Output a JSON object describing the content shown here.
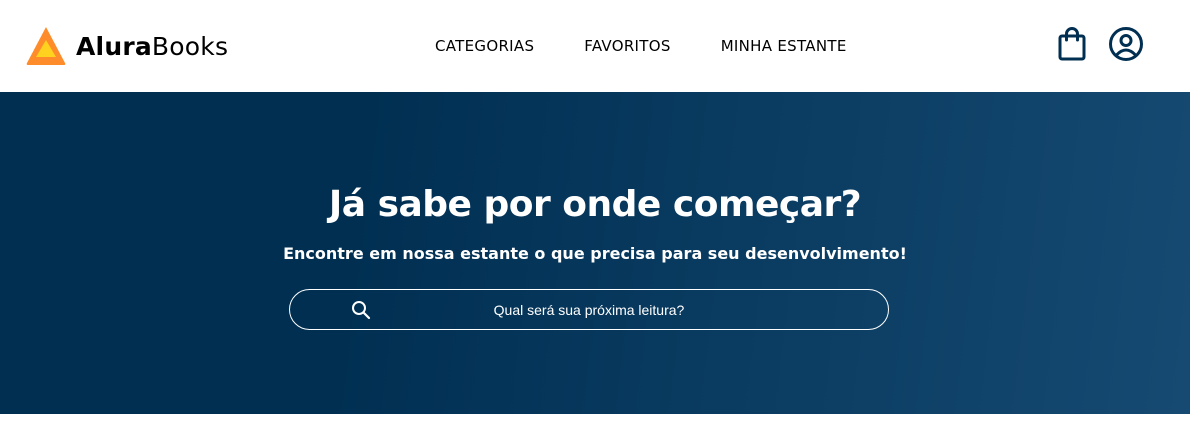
{
  "brand": {
    "name_strong": "Alura",
    "name_rest": "Books",
    "logo_colors": {
      "outer": "#ff8c2a",
      "inner": "#ffd21f"
    }
  },
  "nav": {
    "items": [
      {
        "label": "CATEGORIAS"
      },
      {
        "label": "FAVORITOS"
      },
      {
        "label": "MINHA ESTANTE"
      }
    ]
  },
  "header_icons": {
    "bag": "shopping-bag-icon",
    "user": "user-profile-icon",
    "color": "#002f52"
  },
  "hero": {
    "title": "Já sabe por onde começar?",
    "subtitle": "Encontre em nossa estante o que precisa para seu desenvolvimento!",
    "background_start": "#002f52",
    "background_end": "#164a72"
  },
  "search": {
    "placeholder": "Qual será sua próxima leitura?",
    "icon": "search-icon"
  }
}
